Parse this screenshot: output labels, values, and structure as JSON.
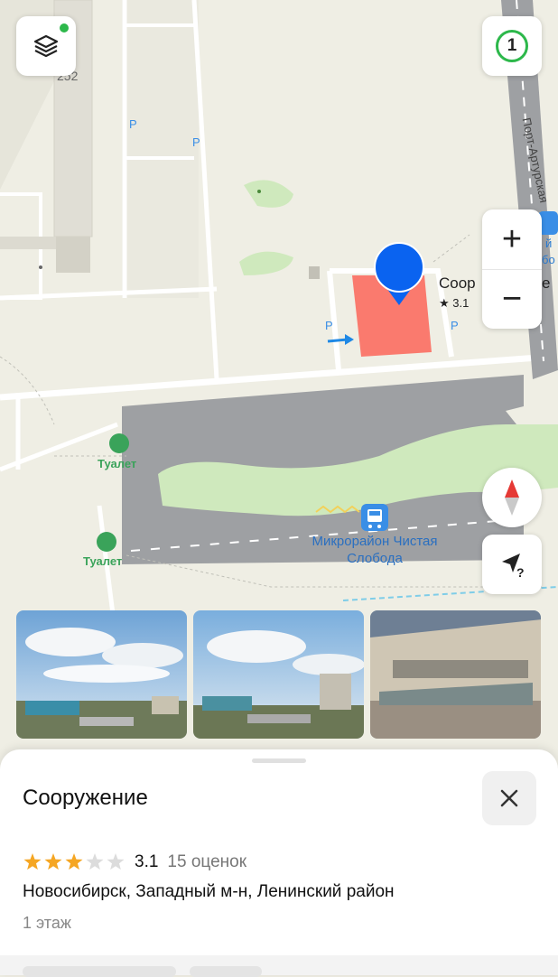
{
  "map": {
    "house_number": "252",
    "street_label": "Порт-Артурская",
    "poi_partial_name": "Соор",
    "poi_partial_suffix": "е",
    "poi_rating": "★ 3.1",
    "toilet_label_1": "Туалет",
    "toilet_label_2": "Туалет",
    "bus_stop_line1": "Микрорайон Чистая",
    "bus_stop_line2": "Слобода",
    "parking_letter": "P",
    "bus_side_text_1": "й",
    "bus_side_text_2": "бо",
    "traffic_level": "1",
    "zoom_in": "+",
    "zoom_out": "−"
  },
  "photos": [
    {
      "name": "photo-panorama-1"
    },
    {
      "name": "photo-panorama-2"
    },
    {
      "name": "photo-building"
    }
  ],
  "card": {
    "title": "Сооружение",
    "rating_value": "3.1",
    "rating_stars": 3,
    "rating_max": 5,
    "reviews": "15 оценок",
    "address": "Новосибирск, Западный м-н, Ленинский район",
    "floors": "1 этаж"
  },
  "colors": {
    "accent_blue": "#0a63f0",
    "building": "#fa7a6e",
    "traffic_green": "#2db84b",
    "star": "#f5a623"
  }
}
